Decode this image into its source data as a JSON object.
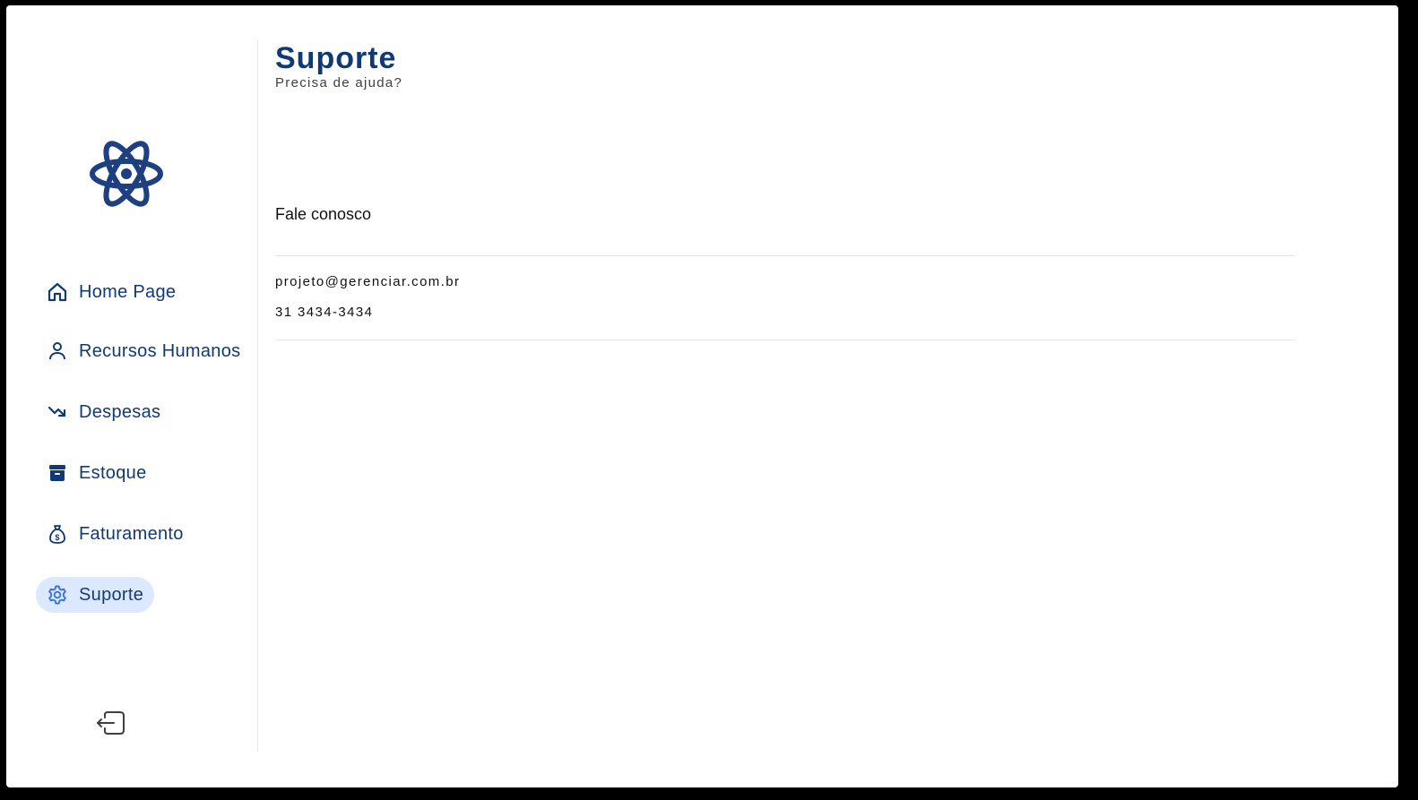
{
  "sidebar": {
    "logo_icon": "atom-icon",
    "items": [
      {
        "label": "Home Page",
        "icon": "home-icon",
        "active": false
      },
      {
        "label": "Recursos Humanos",
        "icon": "user-icon",
        "active": false
      },
      {
        "label": "Despesas",
        "icon": "trending-down-icon",
        "active": false
      },
      {
        "label": "Estoque",
        "icon": "archive-box-icon",
        "active": false
      },
      {
        "label": "Faturamento",
        "icon": "money-bag-icon",
        "active": false
      },
      {
        "label": "Suporte",
        "icon": "gear-icon",
        "active": true
      }
    ],
    "logout_icon": "logout-icon"
  },
  "header": {
    "title": "Suporte",
    "subtitle": "Precisa de ajuda?"
  },
  "contact": {
    "title": "Fale conosco",
    "email": "projeto@gerenciar.com.br",
    "phone": "31 3434-3434"
  },
  "colors": {
    "primary": "#0f3a73",
    "logo": "#1e3f80",
    "active_bg": "#dbe8fd",
    "active_icon": "#3b74d6",
    "divider": "#e4e4e7"
  }
}
